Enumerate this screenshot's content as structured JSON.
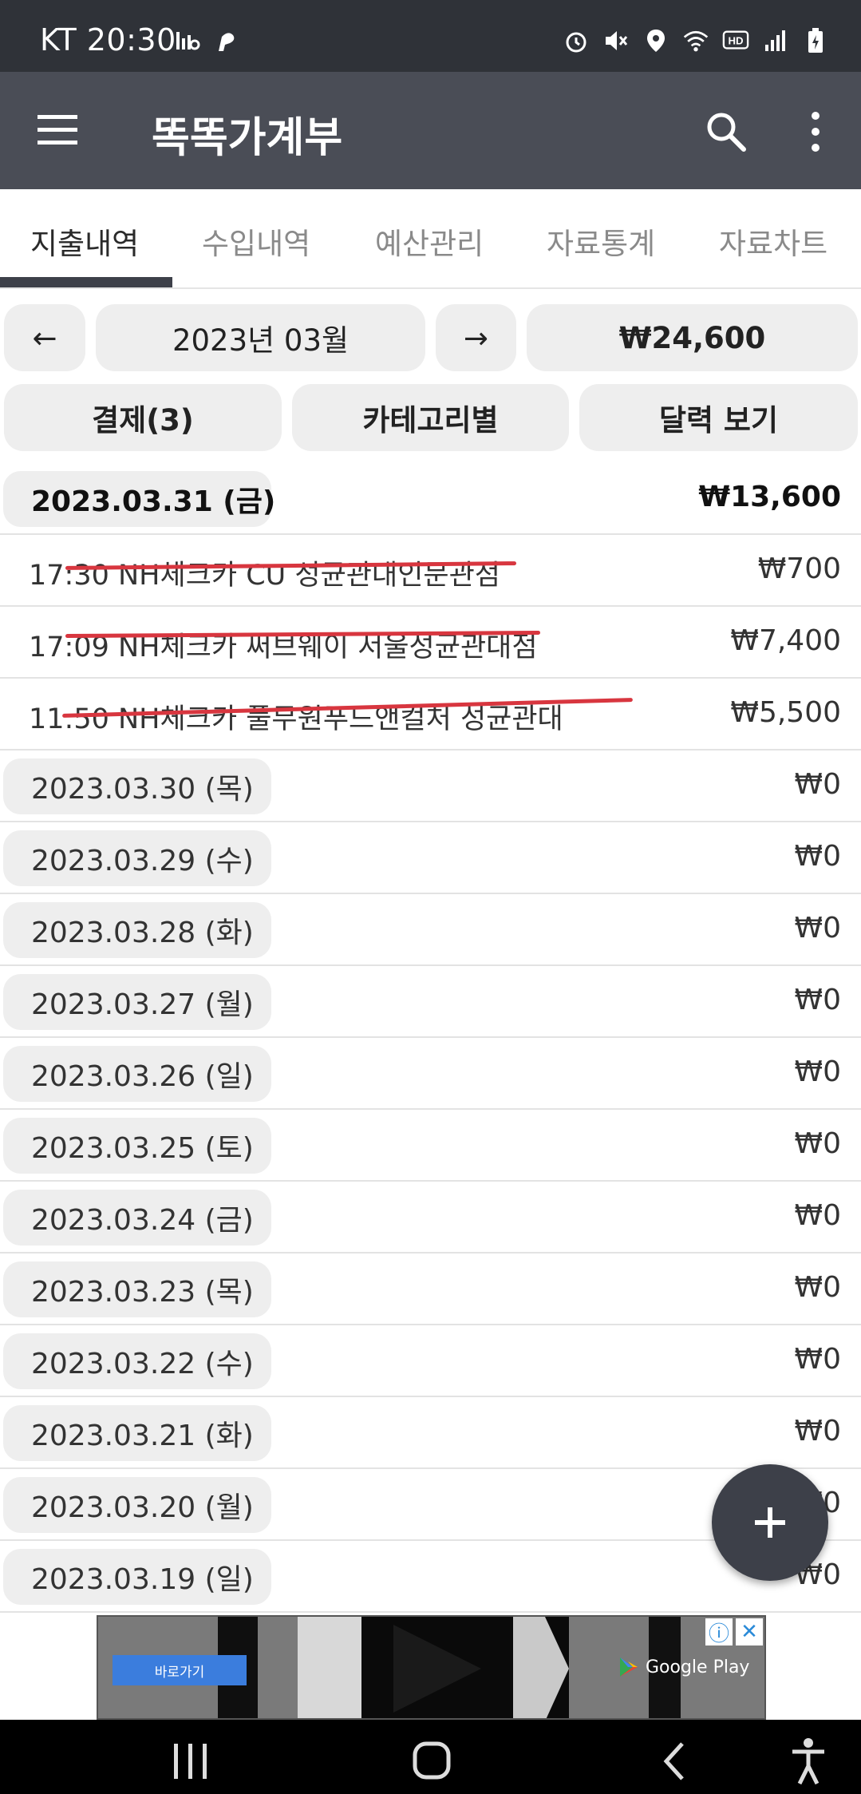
{
  "status_bar": {
    "time": "KT 20:30"
  },
  "app_bar": {
    "title": "똑똑가계부"
  },
  "tabs": [
    {
      "label": "지출내역",
      "active": true
    },
    {
      "label": "수입내역",
      "active": false
    },
    {
      "label": "예산관리",
      "active": false
    },
    {
      "label": "자료통계",
      "active": false
    },
    {
      "label": "자료차트",
      "active": false
    }
  ],
  "month_nav": {
    "prev_label": "←",
    "month_label": "2023년 03월",
    "next_label": "→",
    "total": "₩24,600"
  },
  "filters": {
    "payment_label": "결제(3)",
    "category_label": "카테고리별",
    "calendar_label": "달력 보기"
  },
  "day_rows": [
    {
      "date": "2023.03.31 (금)",
      "amount": "₩13,600",
      "highlight": true
    },
    {
      "date": "2023.03.30 (목)",
      "amount": "₩0"
    },
    {
      "date": "2023.03.29 (수)",
      "amount": "₩0"
    },
    {
      "date": "2023.03.28 (화)",
      "amount": "₩0"
    },
    {
      "date": "2023.03.27 (월)",
      "amount": "₩0"
    },
    {
      "date": "2023.03.26 (일)",
      "amount": "₩0"
    },
    {
      "date": "2023.03.25 (토)",
      "amount": "₩0"
    },
    {
      "date": "2023.03.24 (금)",
      "amount": "₩0"
    },
    {
      "date": "2023.03.23 (목)",
      "amount": "₩0"
    },
    {
      "date": "2023.03.22 (수)",
      "amount": "₩0"
    },
    {
      "date": "2023.03.21 (화)",
      "amount": "₩0"
    },
    {
      "date": "2023.03.20 (월)",
      "amount": "₩0"
    },
    {
      "date": "2023.03.19 (일)",
      "amount": "₩0"
    }
  ],
  "transactions": [
    {
      "text": "17:30  NH체크카  CU 성균관대인문관점",
      "amount": "₩700"
    },
    {
      "text": "17:09  NH체크카  써브웨이 서울성균관대점",
      "amount": "₩7,400"
    },
    {
      "text": "11:50  NH체크카  풀무원푸드앤컬처 성균관대",
      "amount": "₩5,500"
    }
  ],
  "ad": {
    "button_label": "바로가기",
    "store_label": "Google Play"
  },
  "colors": {
    "app_bar": "#4a4d56",
    "status_bar": "#2f3238",
    "strike": "#d8363f",
    "fab": "#3d4049"
  }
}
